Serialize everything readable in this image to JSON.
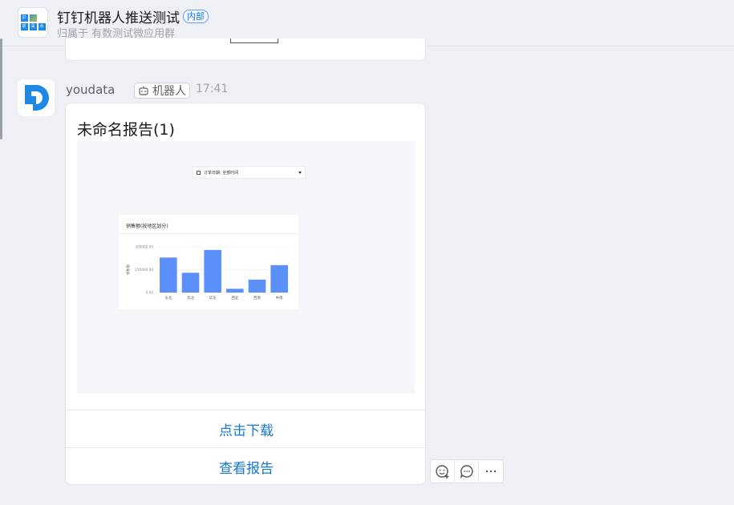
{
  "header": {
    "title": "钉钉机器人推送测试",
    "badge": "内部",
    "subtitle": "归属于 有数测试微应用群",
    "avatar_cells": [
      "识",
      "",
      "",
      "前",
      "清",
      "水"
    ]
  },
  "message": {
    "sender": "youdata",
    "robot_label": "机器人",
    "time": "17:41",
    "card": {
      "title": "未命名报告(1)",
      "report_preview": {
        "filter_label": "订单日期: 全部时间",
        "chart_title": "销售额(按地区划分)",
        "chart_data": {
          "type": "bar",
          "title": "销售额(按地区划分)",
          "xlabel": "",
          "ylabel": "销售额",
          "categories": [
            "东北",
            "华北",
            "华东",
            "西北",
            "西南",
            "中南"
          ],
          "values": [
            230000,
            130000,
            280000,
            25000,
            85000,
            180000
          ],
          "ylim": [
            0,
            300000
          ],
          "yticks": [
            "300000.00",
            "150000.00",
            "0.00"
          ],
          "ytick_values": [
            300000,
            150000,
            0
          ],
          "color": "#5b8ff9",
          "grid": true
        }
      },
      "actions": [
        "点击下载",
        "查看报告"
      ]
    }
  },
  "colors": {
    "accent": "#1678d2",
    "badge": "#1678ff",
    "bar": "#5b8ff9",
    "logo": "#1e88e5"
  },
  "icons": {
    "hover_toolbar": [
      "emoji-add-icon",
      "comment-icon",
      "more-icon"
    ]
  }
}
